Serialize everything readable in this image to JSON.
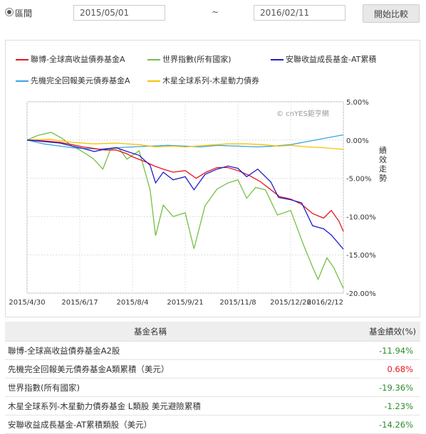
{
  "toolbar": {
    "range_label": "區間",
    "start_date": "2015/05/01",
    "separator": "~",
    "end_date": "2016/02/11",
    "compare_button": "開始比較"
  },
  "watermark": "© cnYES鉅亨網",
  "chart_data": {
    "type": "line",
    "ylabel": "績效走勢",
    "ylim": [
      -20,
      5
    ],
    "y_ticks": [
      "5.00%",
      "0.00%",
      "-5.00%",
      "-10.00%",
      "-15.00%",
      "-20.00%"
    ],
    "y_tick_values": [
      5,
      0,
      -5,
      -10,
      -15,
      -20
    ],
    "x_ticks": [
      "2015/4/30",
      "2015/6/17",
      "2015/8/4",
      "2015/9/21",
      "2015/11/8",
      "2015/12/26",
      "2016/2/12"
    ],
    "x_range": [
      "2015/4/30",
      "2016/2/12"
    ],
    "series": [
      {
        "name": "聯博-全球高收益債券基金A",
        "color": "#e8141c",
        "points": [
          [
            "2015/4/30",
            0.0
          ],
          [
            "2015/5/15",
            -0.1
          ],
          [
            "2015/5/30",
            -0.3
          ],
          [
            "2015/6/10",
            -0.6
          ],
          [
            "2015/6/20",
            -0.9
          ],
          [
            "2015/6/30",
            -1.1
          ],
          [
            "2015/7/10",
            -1.3
          ],
          [
            "2015/7/20",
            -1.3
          ],
          [
            "2015/7/30",
            -1.8
          ],
          [
            "2015/8/4",
            -2.2
          ],
          [
            "2015/8/15",
            -2.8
          ],
          [
            "2015/8/24",
            -3.4
          ],
          [
            "2015/9/1",
            -3.8
          ],
          [
            "2015/9/10",
            -4.2
          ],
          [
            "2015/9/21",
            -4.0
          ],
          [
            "2015/10/1",
            -5.0
          ],
          [
            "2015/10/10",
            -4.2
          ],
          [
            "2015/10/20",
            -3.6
          ],
          [
            "2015/10/30",
            -3.6
          ],
          [
            "2015/11/8",
            -4.0
          ],
          [
            "2015/11/18",
            -4.6
          ],
          [
            "2015/11/28",
            -5.4
          ],
          [
            "2015/12/8",
            -6.5
          ],
          [
            "2015/12/16",
            -7.4
          ],
          [
            "2015/12/26",
            -7.7
          ],
          [
            "2016/1/5",
            -8.4
          ],
          [
            "2016/1/15",
            -9.6
          ],
          [
            "2016/1/25",
            -10.2
          ],
          [
            "2016/2/1",
            -9.2
          ],
          [
            "2016/2/8",
            -10.6
          ],
          [
            "2016/2/12",
            -11.94
          ]
        ]
      },
      {
        "name": "世界指數(所有國家)",
        "color": "#74bf44",
        "points": [
          [
            "2015/4/30",
            0.0
          ],
          [
            "2015/5/10",
            0.6
          ],
          [
            "2015/5/22",
            1.0
          ],
          [
            "2015/6/1",
            0.2
          ],
          [
            "2015/6/10",
            -0.8
          ],
          [
            "2015/6/17",
            -1.3
          ],
          [
            "2015/6/29",
            -2.4
          ],
          [
            "2015/7/8",
            -3.8
          ],
          [
            "2015/7/15",
            -1.2
          ],
          [
            "2015/7/22",
            -1.0
          ],
          [
            "2015/7/30",
            -2.5
          ],
          [
            "2015/8/10",
            -1.4
          ],
          [
            "2015/8/20",
            -6.5
          ],
          [
            "2015/8/25",
            -12.5
          ],
          [
            "2015/9/1",
            -8.5
          ],
          [
            "2015/9/10",
            -10.0
          ],
          [
            "2015/9/21",
            -9.5
          ],
          [
            "2015/9/29",
            -14.2
          ],
          [
            "2015/10/9",
            -8.6
          ],
          [
            "2015/10/20",
            -6.4
          ],
          [
            "2015/10/30",
            -5.6
          ],
          [
            "2015/11/8",
            -5.2
          ],
          [
            "2015/11/16",
            -7.6
          ],
          [
            "2015/11/24",
            -6.2
          ],
          [
            "2015/12/3",
            -6.5
          ],
          [
            "2015/12/14",
            -9.8
          ],
          [
            "2015/12/26",
            -9.2
          ],
          [
            "2016/1/7",
            -13.8
          ],
          [
            "2016/1/15",
            -16.6
          ],
          [
            "2016/1/20",
            -18.2
          ],
          [
            "2016/1/28",
            -15.4
          ],
          [
            "2016/2/3",
            -16.6
          ],
          [
            "2016/2/12",
            -19.36
          ]
        ]
      },
      {
        "name": "安聯收益成長基金-AT累積",
        "color": "#1f1ec8",
        "points": [
          [
            "2015/4/30",
            0.0
          ],
          [
            "2015/5/15",
            -0.2
          ],
          [
            "2015/5/30",
            -0.4
          ],
          [
            "2015/6/10",
            -0.8
          ],
          [
            "2015/6/20",
            -1.1
          ],
          [
            "2015/6/30",
            -1.5
          ],
          [
            "2015/7/10",
            -1.2
          ],
          [
            "2015/7/20",
            -1.0
          ],
          [
            "2015/7/30",
            -1.5
          ],
          [
            "2015/8/10",
            -2.0
          ],
          [
            "2015/8/20",
            -3.3
          ],
          [
            "2015/8/25",
            -5.6
          ],
          [
            "2015/9/1",
            -4.2
          ],
          [
            "2015/9/10",
            -5.2
          ],
          [
            "2015/9/21",
            -4.8
          ],
          [
            "2015/9/29",
            -6.5
          ],
          [
            "2015/10/9",
            -4.5
          ],
          [
            "2015/10/20",
            -3.8
          ],
          [
            "2015/10/30",
            -3.4
          ],
          [
            "2015/11/8",
            -3.7
          ],
          [
            "2015/11/16",
            -4.8
          ],
          [
            "2015/11/26",
            -3.8
          ],
          [
            "2015/12/8",
            -5.5
          ],
          [
            "2015/12/15",
            -7.5
          ],
          [
            "2015/12/26",
            -7.8
          ],
          [
            "2016/1/5",
            -8.2
          ],
          [
            "2016/1/15",
            -11.2
          ],
          [
            "2016/1/25",
            -11.6
          ],
          [
            "2016/2/1",
            -12.4
          ],
          [
            "2016/2/12",
            -14.26
          ]
        ]
      },
      {
        "name": "先機完全回報美元債券基金A",
        "color": "#3aa3e3",
        "points": [
          [
            "2015/4/30",
            0.0
          ],
          [
            "2015/5/15",
            -0.5
          ],
          [
            "2015/5/30",
            -0.8
          ],
          [
            "2015/6/10",
            -1.0
          ],
          [
            "2015/6/20",
            -1.1
          ],
          [
            "2015/7/5",
            -1.2
          ],
          [
            "2015/7/20",
            -1.0
          ],
          [
            "2015/8/4",
            -0.9
          ],
          [
            "2015/8/20",
            -0.8
          ],
          [
            "2015/9/5",
            -0.7
          ],
          [
            "2015/9/21",
            -0.8
          ],
          [
            "2015/10/5",
            -0.9
          ],
          [
            "2015/10/20",
            -0.7
          ],
          [
            "2015/11/8",
            -0.8
          ],
          [
            "2015/11/25",
            -0.9
          ],
          [
            "2015/12/10",
            -0.8
          ],
          [
            "2015/12/26",
            -0.6
          ],
          [
            "2016/1/10",
            -0.2
          ],
          [
            "2016/1/25",
            0.2
          ],
          [
            "2016/2/12",
            0.68
          ]
        ]
      },
      {
        "name": "木星全球系列-木星動力債券",
        "color": "#f6c200",
        "points": [
          [
            "2015/4/30",
            0.0
          ],
          [
            "2015/5/20",
            0.1
          ],
          [
            "2015/6/10",
            -0.3
          ],
          [
            "2015/6/30",
            -0.5
          ],
          [
            "2015/7/20",
            -0.4
          ],
          [
            "2015/8/10",
            -0.6
          ],
          [
            "2015/8/25",
            -0.9
          ],
          [
            "2015/9/10",
            -0.8
          ],
          [
            "2015/9/21",
            -0.9
          ],
          [
            "2015/10/10",
            -0.7
          ],
          [
            "2015/10/30",
            -0.5
          ],
          [
            "2015/11/15",
            -0.5
          ],
          [
            "2015/12/1",
            -0.6
          ],
          [
            "2015/12/15",
            -0.8
          ],
          [
            "2015/12/26",
            -0.7
          ],
          [
            "2016/1/10",
            -0.9
          ],
          [
            "2016/1/25",
            -1.0
          ],
          [
            "2016/2/12",
            -1.23
          ]
        ]
      }
    ]
  },
  "table": {
    "headers": [
      "基金名稱",
      "基金績效(%)"
    ],
    "rows": [
      {
        "name": "聯博-全球高收益債券基金A2股",
        "value": "-11.94%",
        "color": "#2e8b2e"
      },
      {
        "name": "先機完全回報美元債券基金A類累積（美元）",
        "value": "0.68%",
        "color": "#e8141c"
      },
      {
        "name": "世界指數(所有國家)",
        "value": "-19.36%",
        "color": "#2e8b2e"
      },
      {
        "name": "木星全球系列-木星動力債券基金 L類股 美元避險累積",
        "value": "-1.23%",
        "color": "#2e8b2e"
      },
      {
        "name": "安聯收益成長基金-AT累積類股（美元）",
        "value": "-14.26%",
        "color": "#2e8b2e"
      }
    ]
  }
}
